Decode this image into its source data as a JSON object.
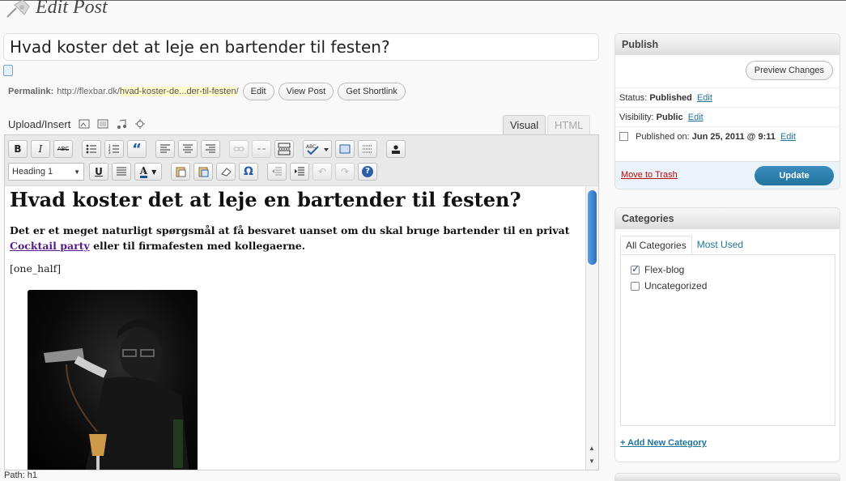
{
  "page": {
    "title": "Edit Post"
  },
  "post": {
    "title": "Hvad koster det at leje en bartender til festen?",
    "permalink_label": "Permalink:",
    "permalink_base": "http://flexbar.dk/",
    "permalink_slug": "hvad-koster-de...der-til-festen",
    "permalink_trail": "/",
    "buttons": {
      "edit": "Edit",
      "view": "View Post",
      "shortlink": "Get Shortlink"
    }
  },
  "media": {
    "label": "Upload/Insert",
    "icons": [
      "image-icon",
      "video-icon",
      "audio-icon",
      "media-icon"
    ]
  },
  "editor_tabs": {
    "visual": "Visual",
    "html": "HTML"
  },
  "toolbar": {
    "bold": "B",
    "italic": "I",
    "strike": "ABC",
    "quote": "“",
    "format_value": "Heading 1",
    "underline": "U",
    "text_color": "A",
    "omega": "Ω",
    "help": "?"
  },
  "content": {
    "heading": "Hvad koster det at leje en bartender til festen?",
    "para_before": "Det er et meget naturligt spørgsmål at få besvaret uanset om du skal bruge bartender til en privat ",
    "para_link": "Cocktail party",
    "para_after": " eller til firmafesten med kollegaerne.",
    "shortcode": "[one_half]",
    "path": "Path: h1"
  },
  "publish": {
    "heading": "Publish",
    "preview": "Preview Changes",
    "status_label": "Status:",
    "status_value": "Published",
    "visibility_label": "Visibility:",
    "visibility_value": "Public",
    "published_label": "Published on:",
    "published_value": "Jun 25, 2011 @ 9:11",
    "edit_link": "Edit",
    "trash": "Move to Trash",
    "update": "Update"
  },
  "categories": {
    "heading": "Categories",
    "tabs": [
      "All Categories",
      "Most Used"
    ],
    "items": [
      {
        "label": "Flex-blog",
        "checked": true
      },
      {
        "label": "Uncategorized",
        "checked": false
      }
    ],
    "add_new": "+ Add New Category"
  },
  "colors": {
    "accent": "#21759b",
    "trash": "#bc0b0b",
    "highlight": "#fffbcc"
  }
}
